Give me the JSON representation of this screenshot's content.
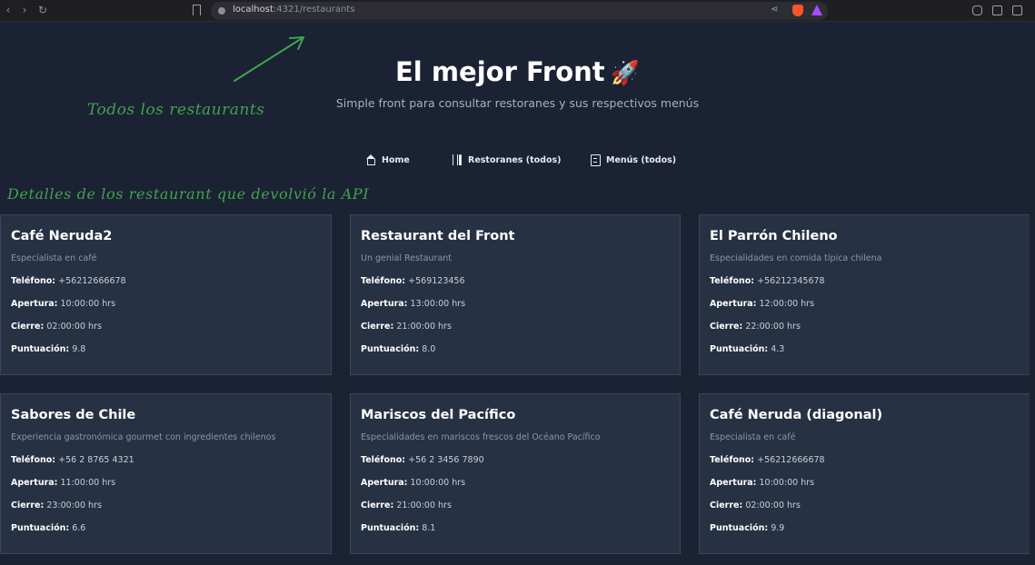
{
  "browser": {
    "url_host": "localhost",
    "url_path": ":4321/restaurants"
  },
  "annotations": {
    "header_note": "Todos los restaurants",
    "cards_note": "Detalles de los restaurant que devolvió la API"
  },
  "header": {
    "title": "El mejor Front",
    "title_emoji": "🚀",
    "subtitle": "Simple front para consultar restoranes y sus respectivos menús"
  },
  "nav": {
    "items": [
      {
        "label": "Home",
        "icon": "home-icon"
      },
      {
        "label": "Restoranes (todos)",
        "icon": "fork-knife-icon"
      },
      {
        "label": "Menús (todos)",
        "icon": "menu-document-icon"
      }
    ]
  },
  "labels": {
    "phone": "Teléfono:",
    "opening": "Apertura:",
    "closing": "Cierre:",
    "score": "Puntuación:"
  },
  "restaurants": [
    {
      "name": "Café Neruda2",
      "description": "Especialista en café",
      "phone": "+56212666678",
      "opening": "10:00:00 hrs",
      "closing": "02:00:00 hrs",
      "score": "9.8"
    },
    {
      "name": "Restaurant del Front",
      "description": "Un genial Restaurant",
      "phone": "+569123456",
      "opening": "13:00:00 hrs",
      "closing": "21:00:00 hrs",
      "score": "8.0"
    },
    {
      "name": "El Parrón Chileno",
      "description": "Especialidades en comida típica chilena",
      "phone": "+56212345678",
      "opening": "12:00:00 hrs",
      "closing": "22:00:00 hrs",
      "score": "4.3"
    },
    {
      "name": "Sabores de Chile",
      "description": "Experiencia gastronómica gourmet con ingredientes chilenos",
      "phone": "+56 2 8765 4321",
      "opening": "11:00:00 hrs",
      "closing": "23:00:00 hrs",
      "score": "6.6"
    },
    {
      "name": "Mariscos del Pacífico",
      "description": "Especialidades en mariscos frescos del Océano Pacífico",
      "phone": "+56 2 3456 7890",
      "opening": "10:00:00 hrs",
      "closing": "21:00:00 hrs",
      "score": "8.1"
    },
    {
      "name": "Café Neruda (diagonal)",
      "description": "Especialista en café",
      "phone": "+56212666678",
      "opening": "10:00:00 hrs",
      "closing": "02:00:00 hrs",
      "score": "9.9"
    }
  ],
  "colors": {
    "background": "#1b2233",
    "card": "#263143",
    "annotation": "#3fa34d"
  }
}
